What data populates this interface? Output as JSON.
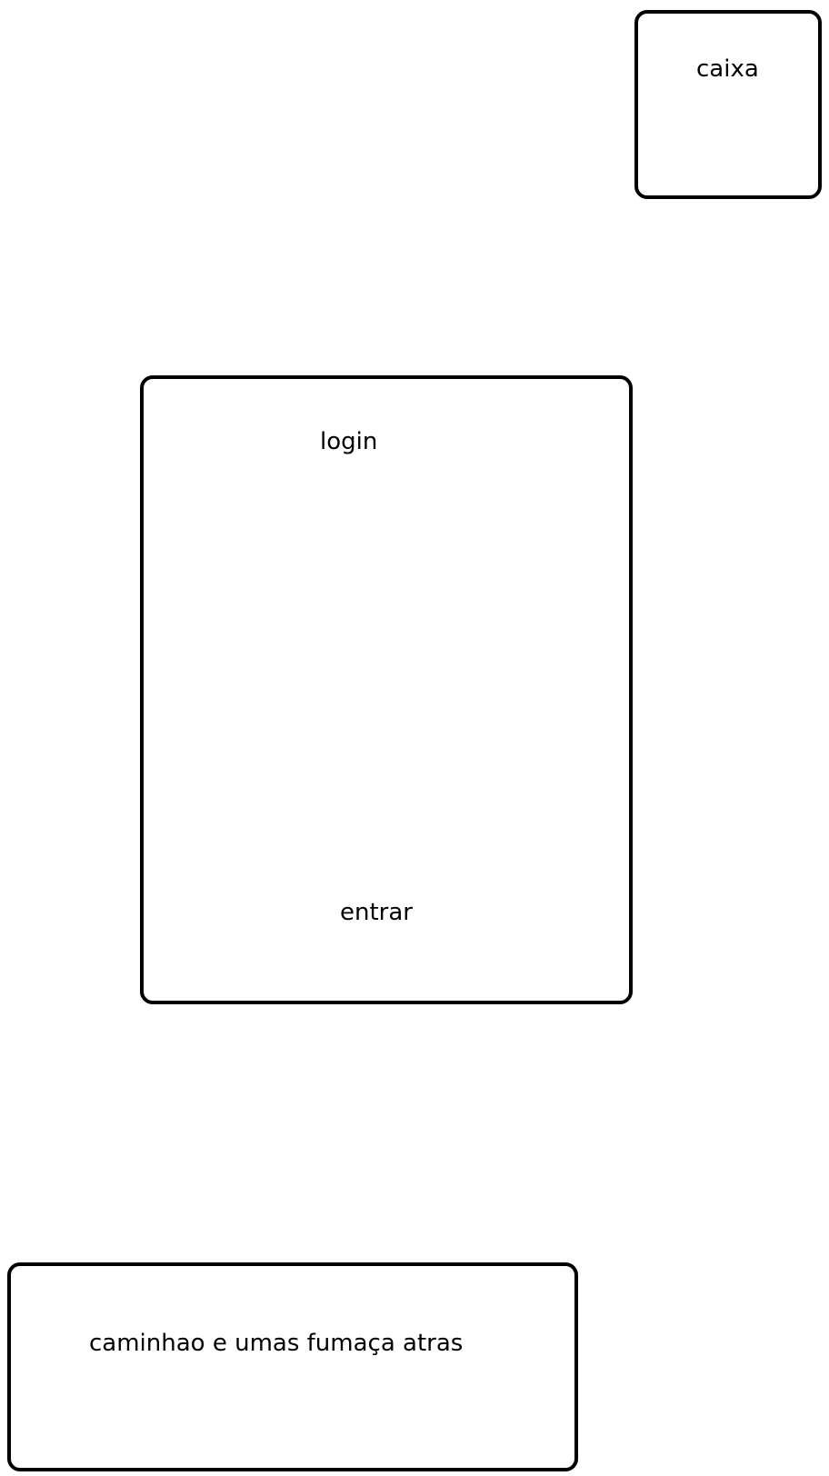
{
  "boxes": {
    "caixa": {
      "label": "caixa"
    },
    "login": {
      "title": "login",
      "button_label": "entrar"
    },
    "truck": {
      "label": "caminhao e umas fumaça atras"
    }
  }
}
